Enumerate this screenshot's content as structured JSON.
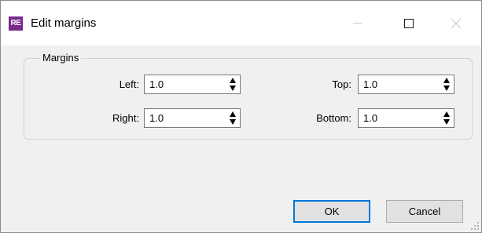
{
  "window": {
    "app_icon_text": "RE",
    "title": "Edit margins",
    "controls": {
      "minimize": "minimize-icon",
      "maximize": "maximize-icon",
      "close": "close-icon"
    }
  },
  "margins": {
    "group_label": "Margins",
    "left": {
      "label": "Left:",
      "value": "1.0"
    },
    "right": {
      "label": "Right:",
      "value": "1.0"
    },
    "top": {
      "label": "Top:",
      "value": "1.0"
    },
    "bottom": {
      "label": "Bottom:",
      "value": "1.0"
    }
  },
  "buttons": {
    "ok": "OK",
    "cancel": "Cancel"
  },
  "colors": {
    "app_icon": "#7a2a8c",
    "default_button_border": "#0078d7",
    "window_bg": "#f0f0f0"
  }
}
